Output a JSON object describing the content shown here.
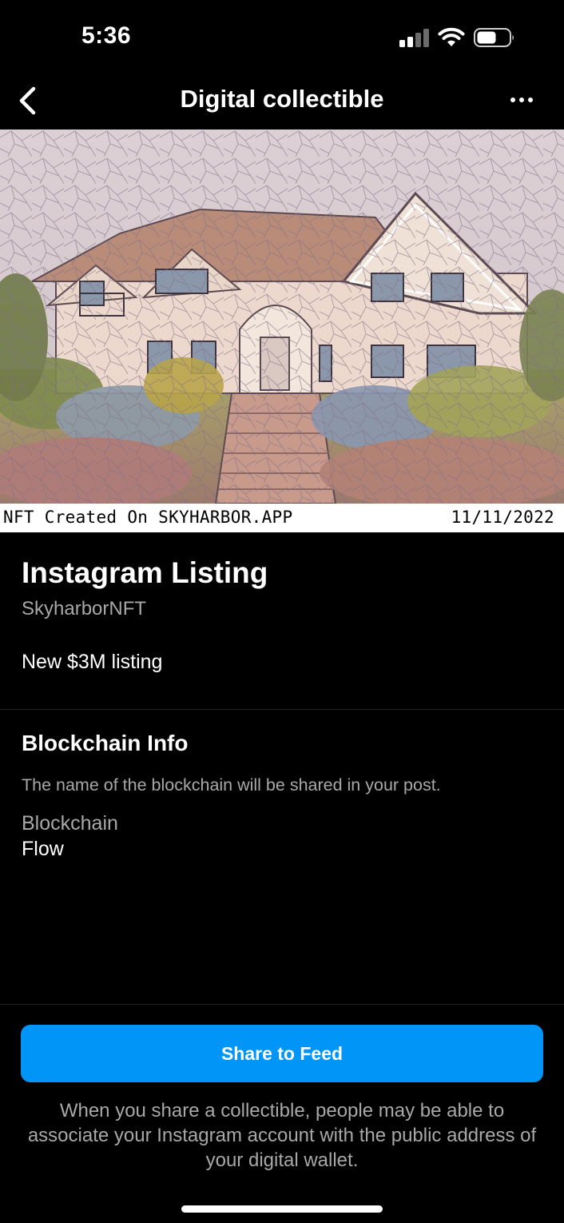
{
  "status_bar": {
    "time": "5:36",
    "icons": [
      "cellular-signal-icon",
      "wifi-icon",
      "battery-icon"
    ]
  },
  "nav": {
    "title": "Digital collectible",
    "back_icon": "chevron-left-icon",
    "more_icon": "more-horizontal-icon"
  },
  "nft": {
    "image_description": "Stained-glass style artwork of a large suburban house with gardens",
    "caption_left": "NFT Created On SKYHARBOR.APP",
    "caption_right": "11/11/2022"
  },
  "collectible": {
    "title": "Instagram Listing",
    "creator": "SkyharborNFT",
    "description": "New $3M listing"
  },
  "blockchain": {
    "heading": "Blockchain Info",
    "note": "The name of the blockchain will be shared in your post.",
    "label": "Blockchain",
    "value": "Flow"
  },
  "footer": {
    "share_label": "Share to Feed",
    "disclaimer": "When you share a collectible, people may be able to associate your Instagram account with the public address of your digital wallet."
  },
  "colors": {
    "background": "#000000",
    "accent": "#0095f6",
    "secondary_text": "#a8a8a8",
    "divider": "#262626"
  }
}
